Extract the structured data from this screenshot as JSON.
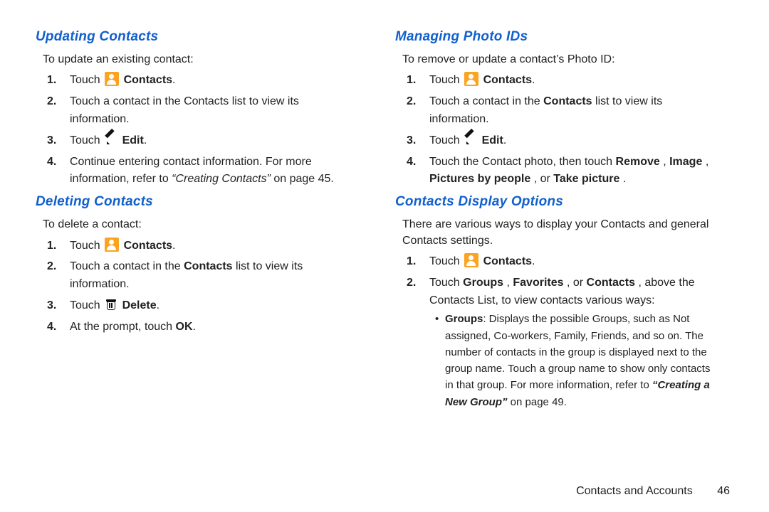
{
  "left": {
    "updating": {
      "heading": "Updating Contacts",
      "intro": "To update an existing contact:",
      "steps": {
        "s1_a": "Touch ",
        "s1_b": "Contacts",
        "s2": "Touch a contact in the Contacts list to view its information.",
        "s3_a": "Touch ",
        "s3_b": "Edit",
        "s4_a": "Continue entering contact information. For more information, refer to ",
        "s4_quote": "“Creating Contacts”",
        "s4_b": " on page 45."
      }
    },
    "deleting": {
      "heading": "Deleting Contacts",
      "intro": "To delete a contact:",
      "steps": {
        "s1_a": "Touch ",
        "s1_b": "Contacts",
        "s2_a": "Touch a contact in the ",
        "s2_b": "Contacts",
        "s2_c": " list to view its information.",
        "s3_a": "Touch ",
        "s3_b": "Delete",
        "s4_a": "At the prompt, touch ",
        "s4_b": "OK"
      }
    }
  },
  "right": {
    "photo": {
      "heading": "Managing Photo IDs",
      "intro": "To remove or update a contact’s Photo ID:",
      "steps": {
        "s1_a": "Touch ",
        "s1_b": "Contacts",
        "s2_a": "Touch a contact in the ",
        "s2_b": "Contacts",
        "s2_c": " list to view its information.",
        "s3_a": "Touch ",
        "s3_b": "Edit",
        "s4_a": "Touch the Contact photo, then touch ",
        "s4_b": "Remove",
        "s4_c": ", ",
        "s4_d": "Image",
        "s4_e": ", ",
        "s4_f": "Pictures by people",
        "s4_g": ", or ",
        "s4_h": "Take picture",
        "s4_i": "."
      }
    },
    "display": {
      "heading": "Contacts Display Options",
      "intro": "There are various ways to display your Contacts and general Contacts settings.",
      "steps": {
        "s1_a": "Touch ",
        "s1_b": "Contacts",
        "s2_a": "Touch ",
        "s2_b": "Groups",
        "s2_c": ", ",
        "s2_d": "Favorites",
        "s2_e": ", or ",
        "s2_f": "Contacts",
        "s2_g": ", above the Contacts List, to view contacts various ways:",
        "bullet_a_label": "Groups",
        "bullet_a_1": ": Displays the possible Groups, such as Not assigned, Co-workers, Family, Friends, and so on. The number of contacts in the group is displayed next to the group name. Touch a group name to show only contacts in that group. For more information, refer to ",
        "bullet_a_quote": "“Creating a New Group”",
        "bullet_a_2": " on page 49."
      }
    }
  },
  "footer": {
    "chapter": "Contacts and Accounts",
    "pagenum": "46"
  },
  "nums": {
    "n1": "1.",
    "n2": "2.",
    "n3": "3.",
    "n4": "4."
  },
  "dot": "."
}
